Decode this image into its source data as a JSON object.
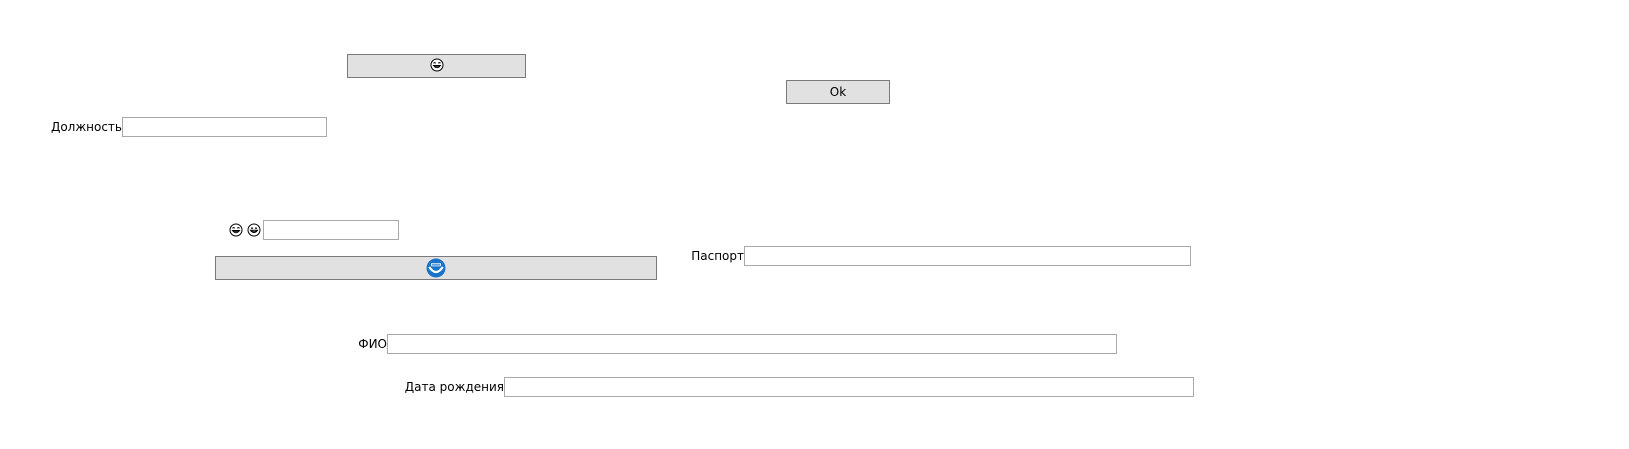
{
  "top_emoji_button": {
    "icon": "laughing-face-icon",
    "glyph": "😂"
  },
  "ok_button": {
    "label": "Ok"
  },
  "position_field": {
    "label": "Должность",
    "value": ""
  },
  "emoji_row": {
    "icon1": "laughing-face-icon",
    "glyph1": "😂",
    "icon2": "grinning-face-icon",
    "glyph2": "😄",
    "value": ""
  },
  "wide_button": {
    "icon": "blue-round-logo-icon"
  },
  "passport_field": {
    "label": "Паспорт",
    "value": ""
  },
  "fio_field": {
    "label": "ФИО",
    "value": ""
  },
  "birthdate_field": {
    "label": "Дата рождения",
    "value": ""
  },
  "colors": {
    "button_bg": "#e1e1e1",
    "button_border": "#7a7a7a",
    "field_border": "#a9a9a9",
    "logo_blue": "#1a73c9"
  }
}
